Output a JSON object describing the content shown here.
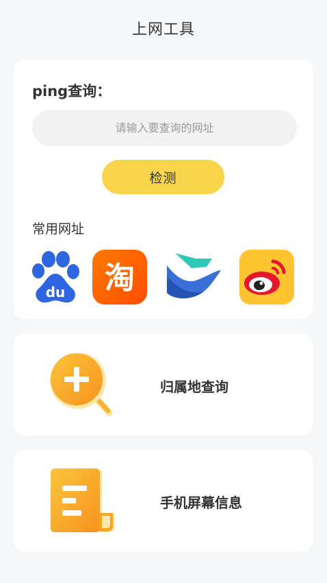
{
  "header": {
    "title": "上网工具"
  },
  "ping": {
    "label": "ping查询：",
    "input_placeholder": "请输入要查询的网址",
    "input_value": "",
    "check_button": "检测"
  },
  "common_sites": {
    "title": "常用网址",
    "items": [
      {
        "icon": "baidu-logo",
        "color": "#2d66e0"
      },
      {
        "icon": "taobao-logo",
        "color": "#ff5a00",
        "glyph": "淘"
      },
      {
        "icon": "feishu-bird-logo",
        "color": "#1f5fc9"
      },
      {
        "icon": "weibo-logo",
        "color": "#ffc531",
        "accent": "#e6162d"
      }
    ]
  },
  "tools": [
    {
      "label": "归属地查询",
      "icon": "search-plus-icon"
    },
    {
      "label": "手机屏幕信息",
      "icon": "document-icon"
    }
  ],
  "colors": {
    "background": "#f6f7f9",
    "card": "#ffffff",
    "accent_yellow": "#f7d44a",
    "icon_orange": "#f9a524"
  }
}
